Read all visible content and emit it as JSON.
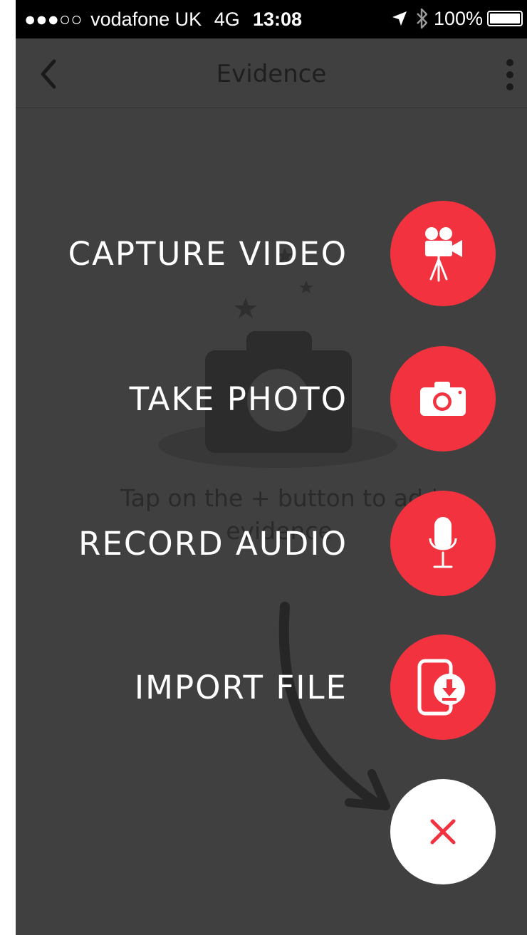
{
  "status_bar": {
    "signal": "●●●○○",
    "carrier": "vodafone UK",
    "network": "4G",
    "time": "13:08",
    "battery": "100%"
  },
  "nav": {
    "title": "Evidence",
    "back_icon": "chevron-left-icon",
    "menu_icon": "vertical-dots-icon"
  },
  "empty_state": {
    "message": "Tap on the + button to add evidence"
  },
  "fab_menu": {
    "items": [
      {
        "label": "CAPTURE VIDEO",
        "icon": "video-camera-icon"
      },
      {
        "label": "TAKE PHOTO",
        "icon": "camera-icon"
      },
      {
        "label": "RECORD AUDIO",
        "icon": "microphone-icon"
      },
      {
        "label": "IMPORT FILE",
        "icon": "phone-download-icon"
      }
    ],
    "close_icon": "close-icon"
  },
  "colors": {
    "accent": "#f2333f",
    "overlay_background": "#404040",
    "status_bar": "#000000"
  }
}
